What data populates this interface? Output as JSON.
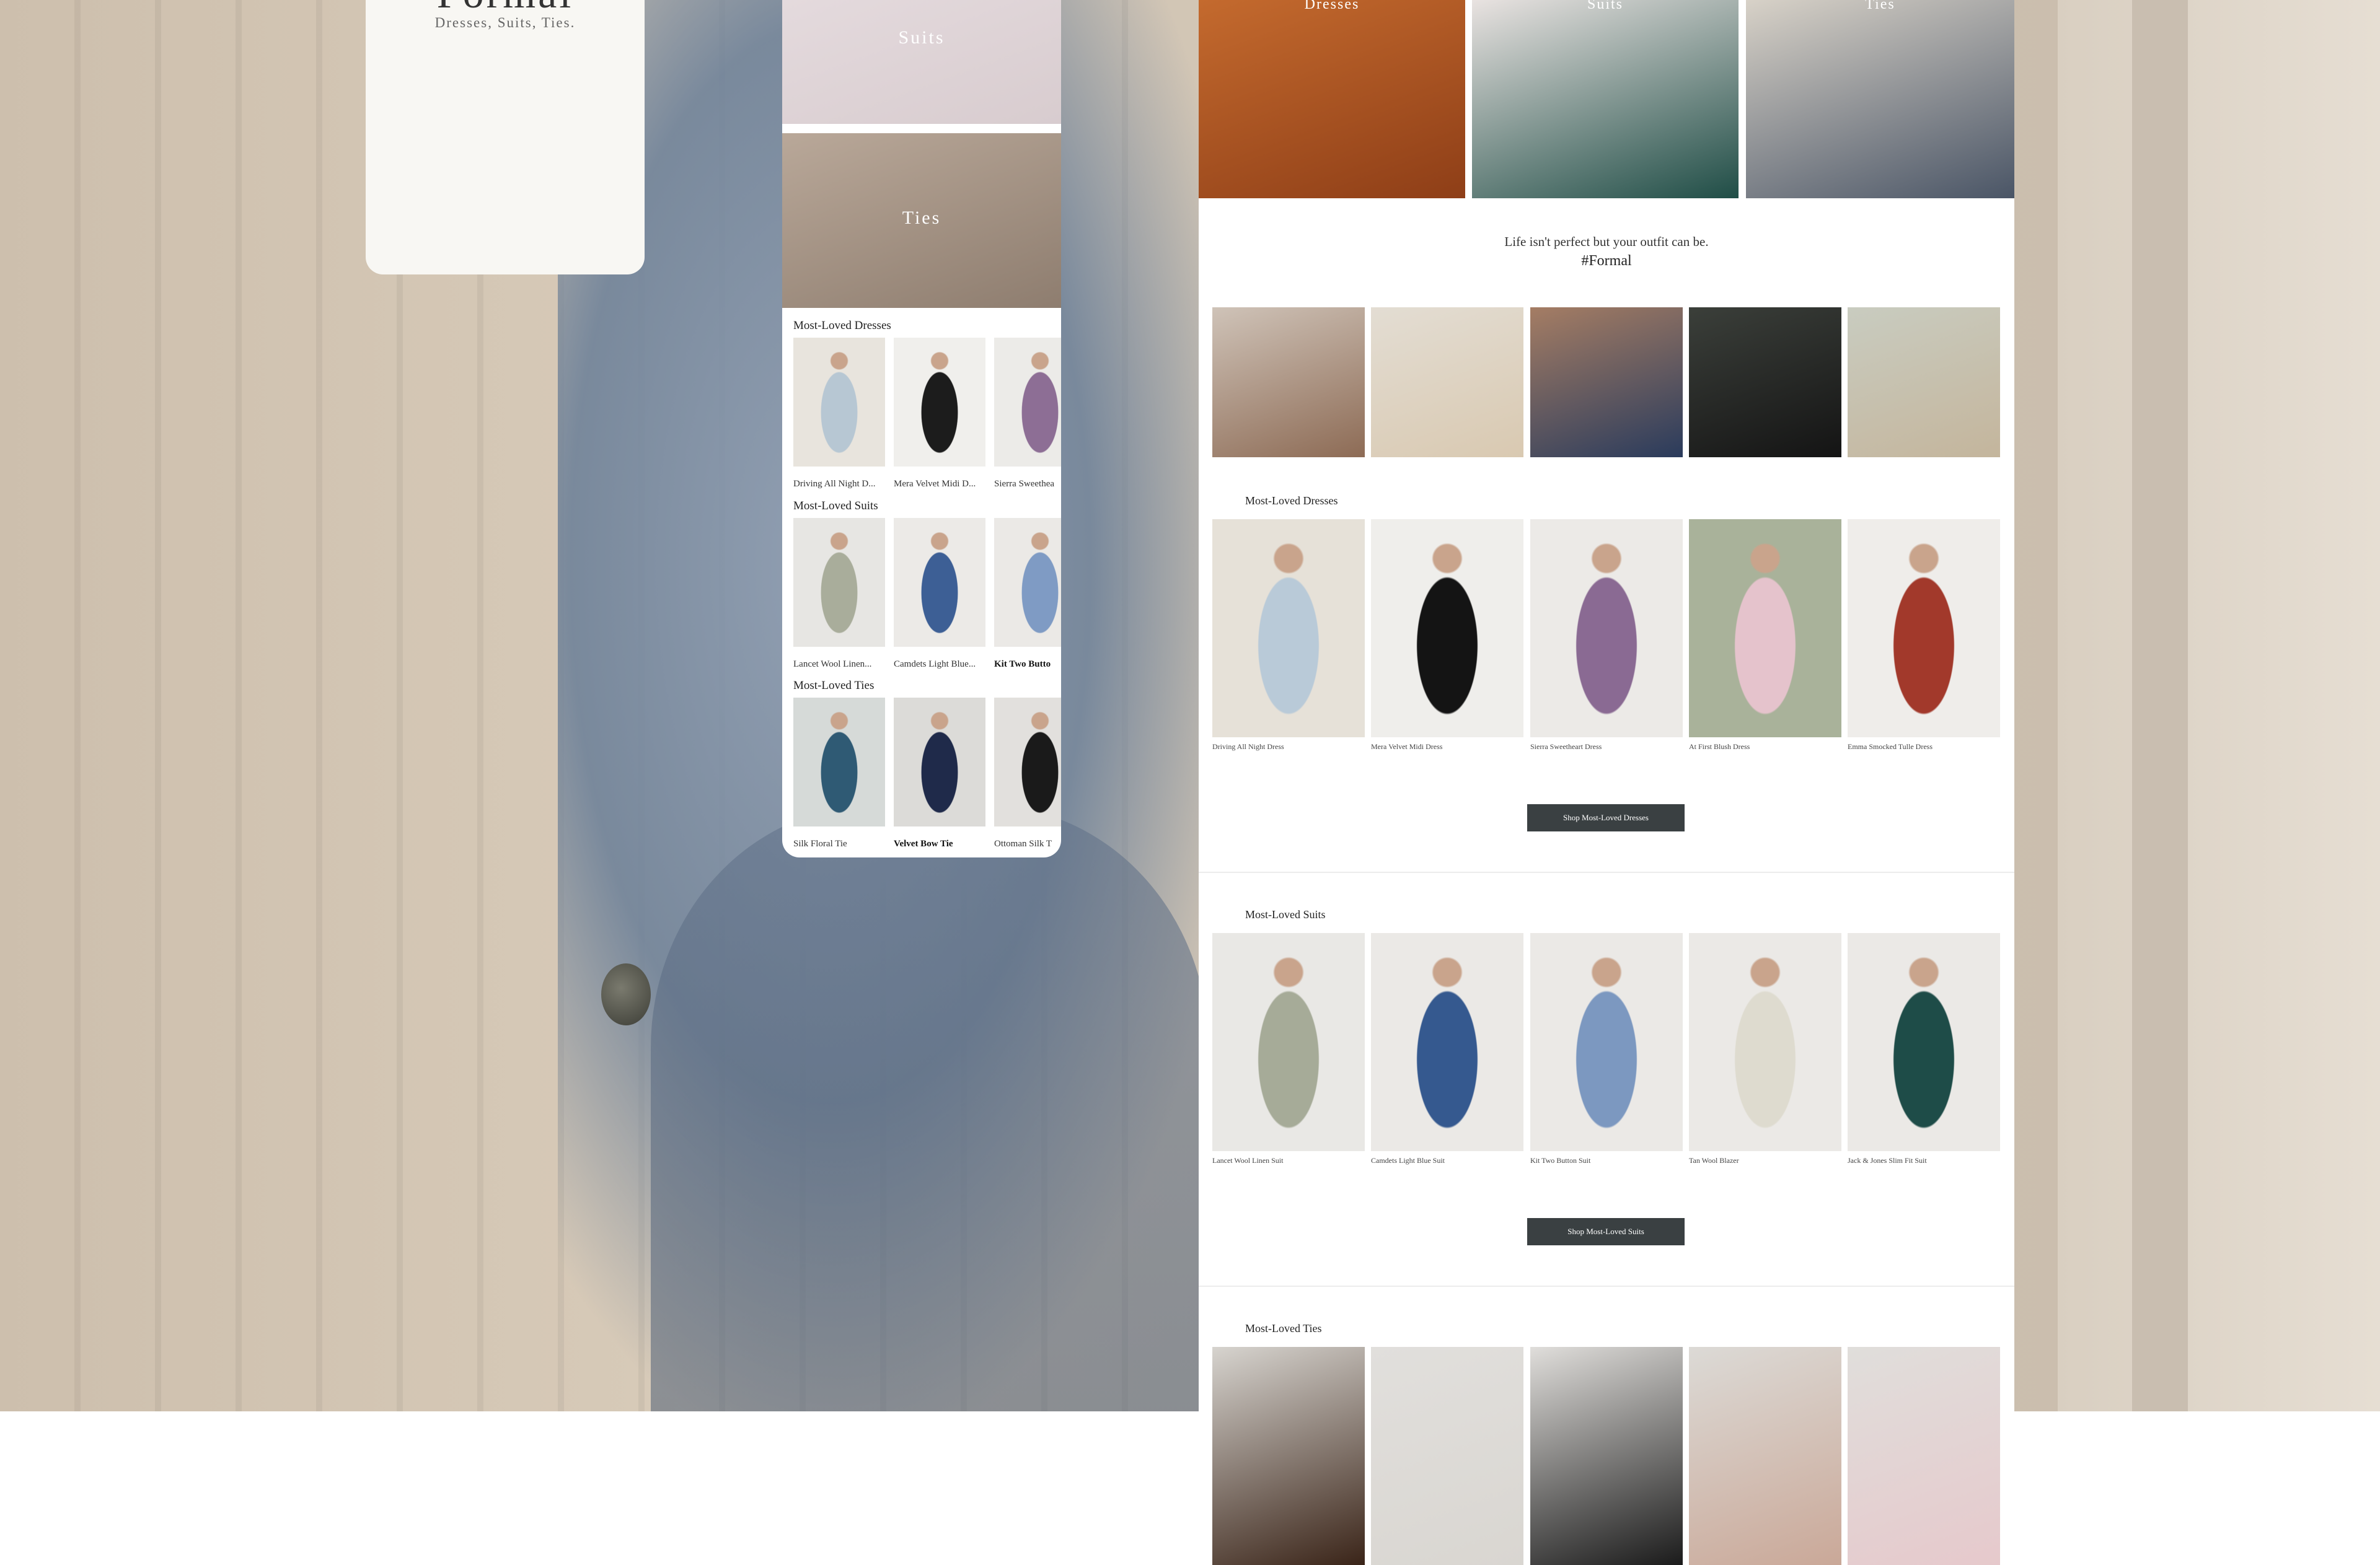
{
  "left_card": {
    "brand": "Formal",
    "subtitle": "Dresses, Suits, Ties."
  },
  "mobile": {
    "tiles": [
      {
        "label": "Suits",
        "colors": [
          "#e4dadd",
          "#d8cccf"
        ]
      },
      {
        "label": "Ties",
        "colors": [
          "#b9a899",
          "#8e7d6f"
        ]
      }
    ],
    "sections": [
      {
        "title": "Most-Loved Dresses",
        "items": [
          {
            "name": "Driving All Night D...",
            "bold": false,
            "colors": [
              "#e8e4dd",
              "#b7c7d3"
            ]
          },
          {
            "name": "Mera Velvet Midi D...",
            "bold": false,
            "colors": [
              "#f0efec",
              "#1c1c1c"
            ]
          },
          {
            "name": "Sierra Sweethea",
            "bold": false,
            "colors": [
              "#ecebe8",
              "#8d6e95"
            ]
          }
        ]
      },
      {
        "title": "Most-Loved Suits",
        "items": [
          {
            "name": "Lancet Wool Linen...",
            "bold": false,
            "colors": [
              "#e7e6e3",
              "#a9ad9b"
            ]
          },
          {
            "name": "Camdets Light Blue...",
            "bold": false,
            "colors": [
              "#eceae7",
              "#3d5f95"
            ]
          },
          {
            "name": "Kit Two Butto",
            "bold": true,
            "colors": [
              "#ebe9e6",
              "#7f9bc4"
            ]
          }
        ]
      },
      {
        "title": "Most-Loved Ties",
        "items": [
          {
            "name": "Silk Floral Tie",
            "bold": false,
            "colors": [
              "#d6dad8",
              "#2f5a74"
            ]
          },
          {
            "name": "Velvet Bow Tie",
            "bold": true,
            "colors": [
              "#dcdbd8",
              "#1f2a4a"
            ]
          },
          {
            "name": "Ottoman Silk T",
            "bold": false,
            "colors": [
              "#e2e0dd",
              "#1a1a1a"
            ]
          }
        ]
      }
    ]
  },
  "desktop": {
    "categories": [
      {
        "label": "Dresses",
        "colors": [
          "#c46a2e",
          "#8e3e17"
        ]
      },
      {
        "label": "Suits",
        "colors": [
          "#e9e3e1",
          "#1f4d46"
        ]
      },
      {
        "label": "Ties",
        "colors": [
          "#d8d2c8",
          "#4a5566"
        ]
      }
    ],
    "tagline": "Life isn't perfect but your outfit can be.",
    "hashtag": "#Formal",
    "ugc_photos": [
      {
        "colors": [
          "#cfc3b8",
          "#8d6b55"
        ]
      },
      {
        "colors": [
          "#e3ddd3",
          "#d9c9b1"
        ]
      },
      {
        "colors": [
          "#a57d64",
          "#2a3b5c"
        ]
      },
      {
        "colors": [
          "#3b3f3a",
          "#141414"
        ]
      },
      {
        "colors": [
          "#c9ccc0",
          "#c4b59c"
        ]
      }
    ],
    "dresses": {
      "title": "Most-Loved Dresses",
      "button": "Shop Most-Loved Dresses",
      "items": [
        {
          "name": "Driving All Night Dress",
          "colors": [
            "#e6e1d8",
            "#b9cad8"
          ]
        },
        {
          "name": "Mera Velvet Midi Dress",
          "colors": [
            "#efeeeb",
            "#141414"
          ]
        },
        {
          "name": "Sierra Sweetheart Dress",
          "colors": [
            "#eceae7",
            "#8a6a93"
          ]
        },
        {
          "name": "At First Blush Dress",
          "colors": [
            "#a9b29a",
            "#e5c3cc"
          ]
        },
        {
          "name": "Emma Smocked Tulle Dress",
          "colors": [
            "#efedea",
            "#a2392b"
          ]
        }
      ]
    },
    "suits": {
      "title": "Most-Loved Suits",
      "button": "Shop Most-Loved Suits",
      "items": [
        {
          "name": "Lancet Wool Linen Suit",
          "colors": [
            "#e9e8e5",
            "#a6ab98"
          ]
        },
        {
          "name": "Camdets Light Blue Suit",
          "colors": [
            "#ebe9e6",
            "#35598f"
          ]
        },
        {
          "name": "Kit Two Button Suit",
          "colors": [
            "#ebe9e6",
            "#7c98c0"
          ]
        },
        {
          "name": "Tan Wool Blazer",
          "colors": [
            "#ebe9e6",
            "#dedbcf"
          ]
        },
        {
          "name": "Jack & Jones Slim Fit Suit",
          "colors": [
            "#ebe9e6",
            "#1e4c48"
          ]
        }
      ]
    },
    "ties": {
      "title": "Most-Loved Ties",
      "items": [
        {
          "colors": [
            "#d7d4cf",
            "#3a2418"
          ]
        },
        {
          "colors": [
            "#e1dfdc",
            "#d9d6d1"
          ]
        },
        {
          "colors": [
            "#e0dedb",
            "#1b1b1b"
          ]
        },
        {
          "colors": [
            "#dcdad6",
            "#caa898"
          ]
        },
        {
          "colors": [
            "#e0dedb",
            "#e6c9cc"
          ]
        }
      ]
    }
  }
}
